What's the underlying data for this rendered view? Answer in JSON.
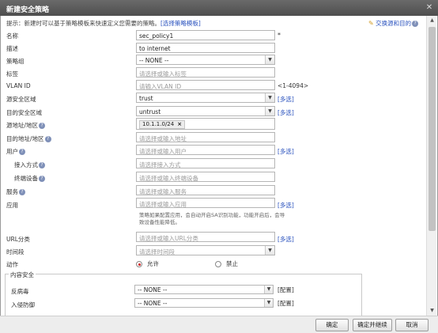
{
  "window": {
    "title": "新建安全策略"
  },
  "tip": {
    "text": "提示：新建时可以基于策略模板来快速定义您需要的策略。",
    "link": "[选择策略模板]"
  },
  "swap_link": "交换源和目的",
  "fields": {
    "name": {
      "label": "名称",
      "value": "sec_policy1",
      "required": "*"
    },
    "description": {
      "label": "描述",
      "value": "to internet"
    },
    "policy_group": {
      "label": "策略组",
      "value": "-- NONE --"
    },
    "tag": {
      "label": "标签",
      "placeholder": "请选择或输入标签"
    },
    "vlan": {
      "label": "VLAN ID",
      "placeholder": "请输入VLAN ID",
      "hint": "<1-4094>"
    },
    "src_zone": {
      "label": "源安全区域",
      "value": "trust",
      "multi": "[多选]"
    },
    "dst_zone": {
      "label": "目的安全区域",
      "value": "untrust",
      "multi": "[多选]"
    },
    "src_addr": {
      "label": "源地址/地区",
      "tag": "10.1.1.0/24",
      "tag_close": "×"
    },
    "dst_addr": {
      "label": "目的地址/地区",
      "placeholder": "请选择或输入地址"
    },
    "user": {
      "label": "用户",
      "placeholder": "请选择或输入用户",
      "multi": "[多选]"
    },
    "access_mode": {
      "label": "接入方式",
      "placeholder": "请选择接入方式"
    },
    "terminal": {
      "label": "终端设备",
      "placeholder": "请选择或输入终端设备"
    },
    "service": {
      "label": "服务",
      "placeholder": "请选择或输入服务"
    },
    "application": {
      "label": "应用",
      "placeholder": "请选择或输入应用",
      "multi": "[多选]",
      "note": "策略如果配置应用，会自动开启SA识别功能，功能开启后，会导致设备性能降低。"
    },
    "url": {
      "label": "URL分类",
      "placeholder": "请选择或输入URL分类",
      "multi": "[多选]"
    },
    "time_range": {
      "label": "时间段",
      "placeholder": "请选择时间段"
    },
    "action": {
      "label": "动作",
      "allow": "允许",
      "deny": "禁止"
    }
  },
  "content_security": {
    "legend": "内容安全",
    "antivirus": {
      "label": "反病毒",
      "value": "-- NONE --",
      "config": "[配置]"
    },
    "ips": {
      "label": "入侵防御",
      "value": "-- NONE --",
      "config": "[配置]"
    }
  },
  "buttons": {
    "ok": "确定",
    "ok_continue": "确定并继续",
    "cancel": "取消"
  },
  "icons": {
    "help": "?",
    "dropdown": "▼",
    "pen": "✎",
    "close": "✕",
    "scroll_up": "▲",
    "scroll_down": "▼"
  }
}
